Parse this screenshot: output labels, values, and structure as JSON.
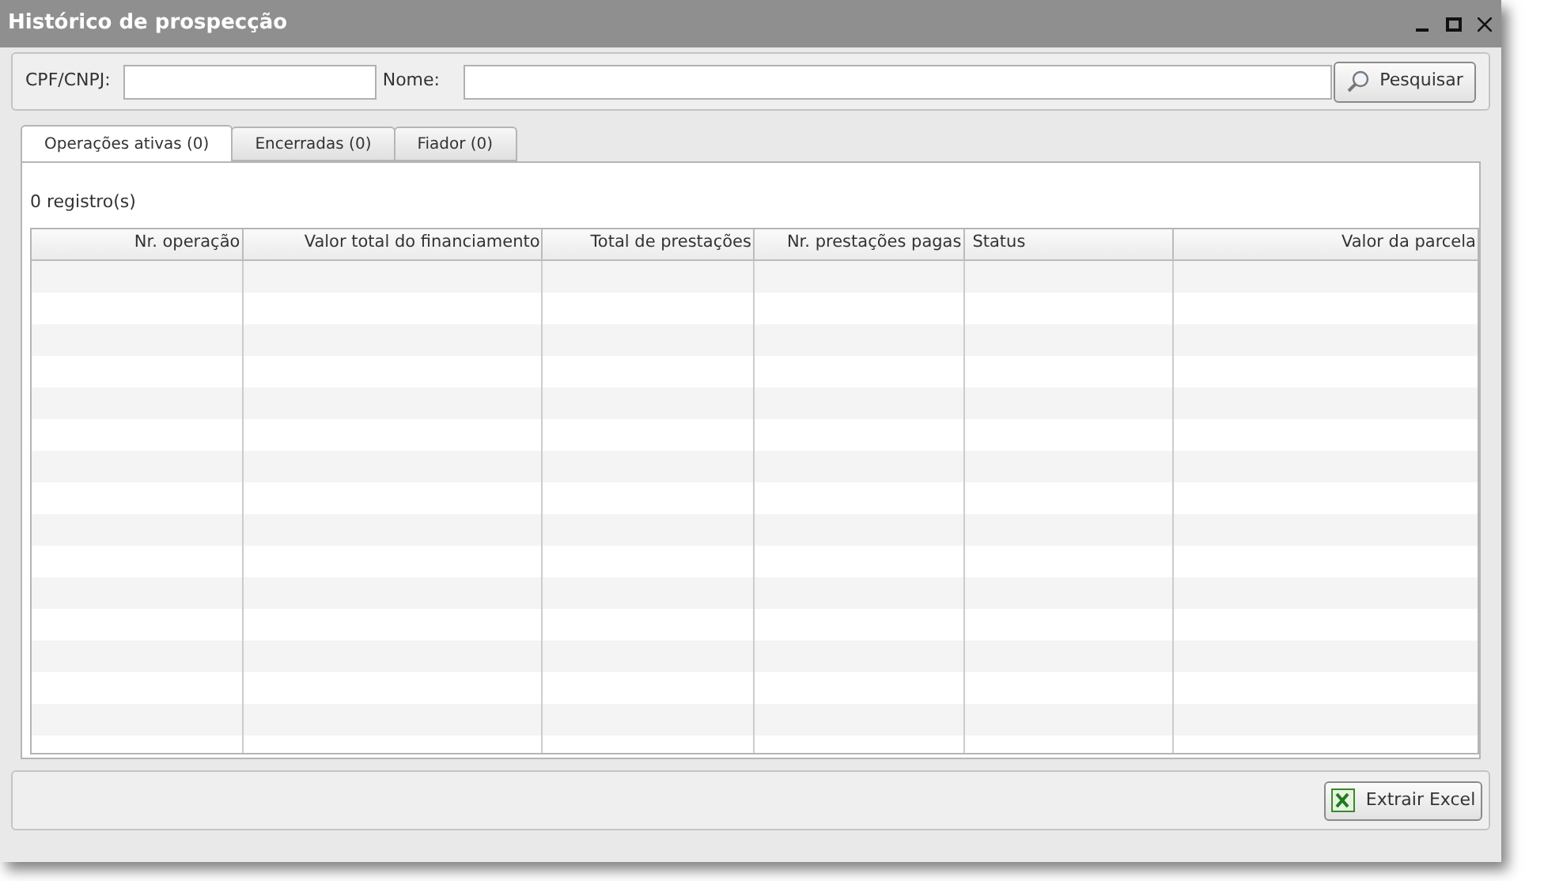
{
  "window": {
    "title": "Histórico de prospecção"
  },
  "search": {
    "fields": [
      {
        "label": "CPF/CNPJ:"
      },
      {
        "label": "Nome:"
      }
    ],
    "button": "Pesquisar"
  },
  "tabs": [
    {
      "label": "Operações ativas (0)",
      "selected": true
    },
    {
      "label": "Encerradas (0)",
      "selected": false
    },
    {
      "label": "Fiador (0)",
      "selected": false
    }
  ],
  "record_count": "0 registro(s)",
  "table": {
    "columns": [
      {
        "label": "Nr. operação"
      },
      {
        "label": "Valor total do financiamento"
      },
      {
        "label": "Total de prestações"
      },
      {
        "label": "Nr. prestações pagas"
      },
      {
        "label": "Status"
      },
      {
        "label": "Valor da parcela"
      }
    ]
  },
  "footer": {
    "button": "Extrair Excel"
  }
}
